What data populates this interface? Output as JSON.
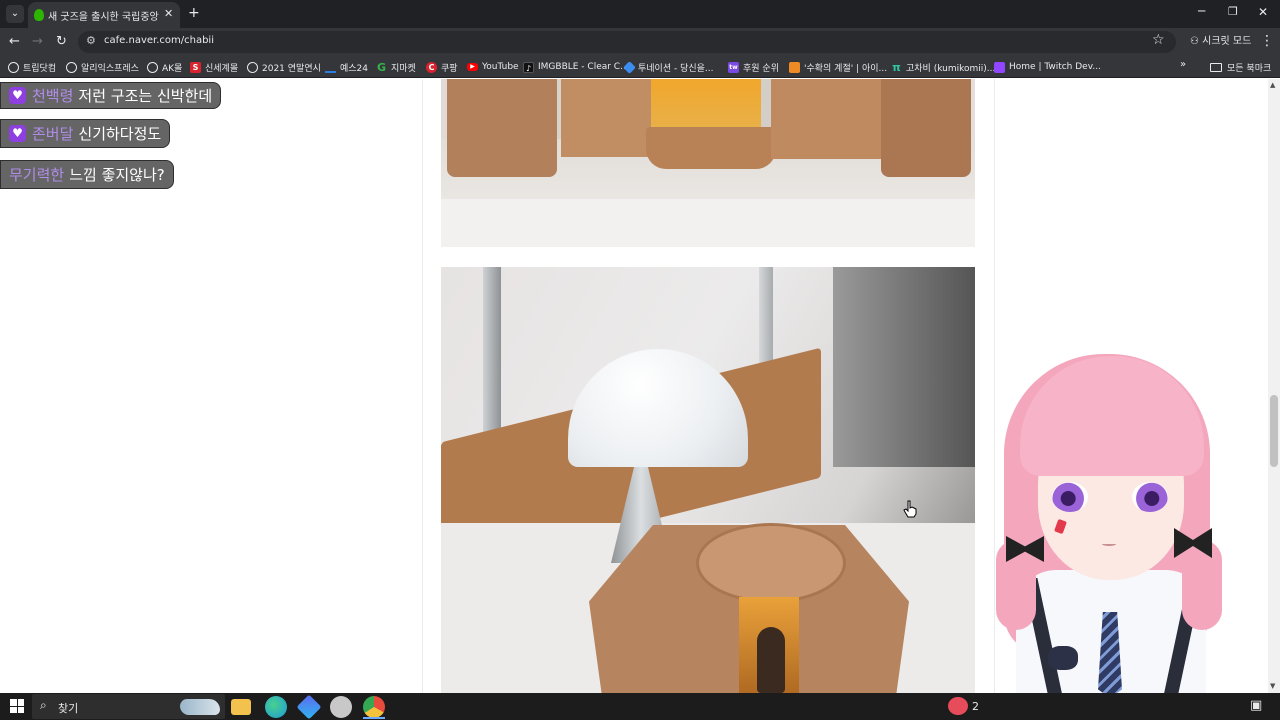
{
  "browser": {
    "tab_title": "새 굿즈을 출시한 국립중앙 박...",
    "tab_close": "✕",
    "new_tab": "+",
    "url": "cafe.naver.com/chabii",
    "secret_mode_label": "시크릿 모드",
    "window_controls": {
      "minimize": "─",
      "maximize": "❐",
      "close": "✕"
    },
    "nav": {
      "back": "←",
      "forward": "→",
      "reload": "↻"
    }
  },
  "bookmarks": [
    {
      "label": "트립닷컴",
      "icon": "compass-icon",
      "color": "#e8eaed"
    },
    {
      "label": "알리익스프레스",
      "icon": "compass-icon",
      "color": "#e8eaed"
    },
    {
      "label": "AK몰",
      "icon": "compass-icon",
      "color": "#e8eaed"
    },
    {
      "label": "신세계몰",
      "icon": "s-icon",
      "color": "#d9232f"
    },
    {
      "label": "2021 연말연시",
      "icon": "g-icon",
      "color": "#e8eaed"
    },
    {
      "label": "예스24",
      "icon": "yes24-icon",
      "color": "#2a7de1"
    },
    {
      "label": "지마켓",
      "icon": "g-icon",
      "color": "#35b34a"
    },
    {
      "label": "쿠팡",
      "icon": "c-icon",
      "color": "#d9232f"
    },
    {
      "label": "YouTube",
      "icon": "youtube-icon",
      "color": "#ff0000"
    },
    {
      "label": "IMGBBLE - Clear C...",
      "icon": "tiktok-icon",
      "color": "#111111"
    },
    {
      "label": "투네이션 - 당신을...",
      "icon": "diamond-icon",
      "color": "#3b8ef0"
    },
    {
      "label": "후원 순위",
      "icon": "tw-icon",
      "color": "#7b4ae2"
    },
    {
      "label": "'수확의 계절' | 아이...",
      "icon": "orange-icon",
      "color": "#f08a24"
    },
    {
      "label": "고차비 (kumikomii)...",
      "icon": "pi-icon",
      "color": "#2fc4a0"
    },
    {
      "label": "Home | Twitch Dev...",
      "icon": "twitch-icon",
      "color": "#9146ff"
    }
  ],
  "bookmarks_more": "»",
  "bookmarks_all": "모든 북마크",
  "chat": [
    {
      "user": "천백령",
      "message": "저런 구조는 신박한데"
    },
    {
      "user": "존버달",
      "message": "신기하다정도"
    },
    {
      "user": "무기력한",
      "message": "느낌 좋지않나?"
    }
  ],
  "chat_heart": "♥",
  "taskbar": {
    "search_label": "찾기",
    "search_icon": "⌕",
    "tray_text": "2",
    "notification_icon": "▣",
    "apps": [
      {
        "name": "file-explorer-icon",
        "color": "#f2c14e"
      },
      {
        "name": "edge-icon",
        "color": "#1e9ad6"
      },
      {
        "name": "copilot-icon",
        "color": "#5b6cf0"
      },
      {
        "name": "circle-app-icon",
        "color": "#c8c8c8"
      },
      {
        "name": "chrome-icon",
        "color": "#e84a3c"
      }
    ]
  }
}
